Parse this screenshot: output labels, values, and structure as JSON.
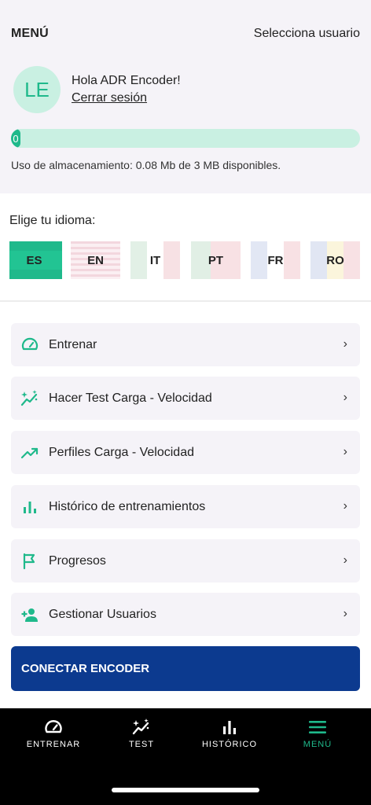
{
  "header": {
    "title": "MENÚ",
    "select_user": "Selecciona usuario"
  },
  "user": {
    "initials": "LE",
    "greeting": "Hola ADR Encoder!",
    "logout": "Cerrar sesión"
  },
  "storage": {
    "bar_label": "0",
    "used_fraction": 0.027,
    "text": "Uso de almacenamiento: 0.08 Mb de 3 MB disponibles."
  },
  "language": {
    "title": "Elige tu idioma:",
    "selected": "ES",
    "options": [
      {
        "code": "ES"
      },
      {
        "code": "EN"
      },
      {
        "code": "IT"
      },
      {
        "code": "PT"
      },
      {
        "code": "FR"
      },
      {
        "code": "RO"
      }
    ]
  },
  "menu": {
    "items": [
      {
        "label": "Entrenar",
        "icon": "speedometer-icon"
      },
      {
        "label": "Hacer Test Carga - Velocidad",
        "icon": "sparkle-chart-icon"
      },
      {
        "label": "Perfiles Carga - Velocidad",
        "icon": "trending-up-icon"
      },
      {
        "label": "Histórico de entrenamientos",
        "icon": "bar-chart-icon"
      },
      {
        "label": "Progresos",
        "icon": "flag-icon"
      },
      {
        "label": "Gestionar Usuarios",
        "icon": "add-user-icon"
      }
    ],
    "chevron": "›"
  },
  "connect_button": "CONECTAR ENCODER",
  "tabs": [
    {
      "label": "ENTRENAR",
      "icon": "speedometer-icon"
    },
    {
      "label": "TEST",
      "icon": "sparkle-chart-icon"
    },
    {
      "label": "HISTÓRICO",
      "icon": "bar-chart-icon"
    },
    {
      "label": "MENÚ",
      "icon": "hamburger-icon",
      "active": true
    }
  ],
  "colors": {
    "accent": "#1fb98b",
    "accent_light": "#c9f0e2",
    "primary_button": "#0c3a8f",
    "panel": "#f5f3f8"
  }
}
